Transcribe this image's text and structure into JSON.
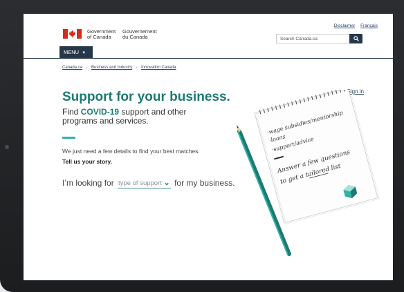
{
  "gov": {
    "name_en_line1": "Government",
    "name_en_line2": "of Canada",
    "name_fr_line1": "Gouvernement",
    "name_fr_line2": "du Canada"
  },
  "lang": {
    "disclaimer": "Disclaimer",
    "francais": "Français"
  },
  "search": {
    "placeholder": "Search Canada.ca"
  },
  "menu": {
    "label": "MENU"
  },
  "breadcrumb": {
    "items": [
      "Canada.ca",
      "Business and Industry",
      "Innovation Canada"
    ]
  },
  "signin": "Sign in",
  "hero": {
    "title": "Support for your business.",
    "subtitle_prefix": "Find ",
    "subtitle_highlight": "COVID-19",
    "subtitle_suffix": " support and other programs and services.",
    "details": "We just need a few details to find your best matches.",
    "story": "Tell us your story.",
    "looking_prefix": "I’m looking for ",
    "select_value": "type of support",
    "looking_suffix": " for my business."
  },
  "notebook": {
    "line1": "·wage subsidies/mentorship",
    "line2": "·loans",
    "line3": "·support/advice",
    "line4": "Answer a few questions",
    "line5": "to get a tailored list"
  },
  "colors": {
    "brand_teal": "#1b7a72",
    "accent": "#2fb3a4",
    "nav_dark": "#26374a",
    "flag_red": "#d52b1e"
  }
}
